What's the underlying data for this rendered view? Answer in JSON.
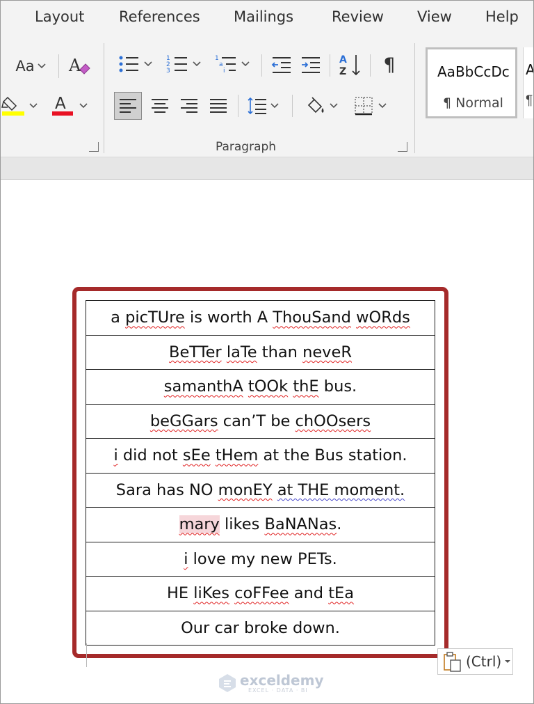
{
  "tabs": [
    {
      "label": "Layout"
    },
    {
      "label": "References"
    },
    {
      "label": "Mailings"
    },
    {
      "label": "Review"
    },
    {
      "label": "View"
    },
    {
      "label": "Help"
    }
  ],
  "ribbon": {
    "font": {
      "change_case_label": "Aa",
      "highlight_color": "#ffff00",
      "font_color_label": "A",
      "font_color": "#e81123"
    },
    "paragraph": {
      "group_label": "Paragraph",
      "sort_label": "A Z",
      "pilcrow": "¶",
      "active_alignment": "left"
    },
    "styles": {
      "gallery_sample": "AaBbCcDc",
      "selected_style": "¶ Normal",
      "next_sample": "A",
      "next_name": "¶"
    }
  },
  "document": {
    "rows": [
      [
        {
          "t": "a "
        },
        {
          "t": "picTUre",
          "u": "s"
        },
        {
          "t": " is worth A "
        },
        {
          "t": "ThouSand",
          "u": "s"
        },
        {
          "t": " "
        },
        {
          "t": "wORds",
          "u": "s"
        }
      ],
      [
        {
          "t": "BeTTer",
          "u": "s"
        },
        {
          "t": " "
        },
        {
          "t": "laTe",
          "u": "s"
        },
        {
          "t": " than "
        },
        {
          "t": "neveR",
          "u": "s"
        }
      ],
      [
        {
          "t": "samanthA",
          "u": "s"
        },
        {
          "t": " "
        },
        {
          "t": "tOOk",
          "u": "s"
        },
        {
          "t": " "
        },
        {
          "t": "thE",
          "u": "s"
        },
        {
          "t": " bus."
        }
      ],
      [
        {
          "t": "beGGars",
          "u": "s"
        },
        {
          "t": " can’T be "
        },
        {
          "t": "chOOsers",
          "u": "s"
        }
      ],
      [
        {
          "t": "i",
          "u": "s"
        },
        {
          "t": " did not "
        },
        {
          "t": "sEe",
          "u": "s"
        },
        {
          "t": " "
        },
        {
          "t": "tHem",
          "u": "s"
        },
        {
          "t": " at the Bus station."
        }
      ],
      [
        {
          "t": "Sara has NO "
        },
        {
          "t": "monEY",
          "u": "s"
        },
        {
          "t": " "
        },
        {
          "t": "at THE moment.",
          "u": "g"
        }
      ],
      [
        {
          "t": "mary",
          "u": "s",
          "h": true
        },
        {
          "t": " likes "
        },
        {
          "t": "BaNANas",
          "u": "s"
        },
        {
          "t": "."
        }
      ],
      [
        {
          "t": "i",
          "u": "s"
        },
        {
          "t": " love my new PETs."
        }
      ],
      [
        {
          "t": "HE "
        },
        {
          "t": "liKes",
          "u": "s"
        },
        {
          "t": " "
        },
        {
          "t": "coFFee",
          "u": "s"
        },
        {
          "t": " and "
        },
        {
          "t": "tEa",
          "u": "s"
        }
      ],
      [
        {
          "t": "Our car broke down."
        }
      ]
    ],
    "paste_options_label": "(Ctrl)"
  },
  "watermark": {
    "name": "exceldemy",
    "tagline": "EXCEL · DATA · BI"
  },
  "colors": {
    "selection_box": "#a52a2a",
    "spelling_squiggle": "#e02020",
    "grammar_squiggle": "#4c4ccc"
  }
}
